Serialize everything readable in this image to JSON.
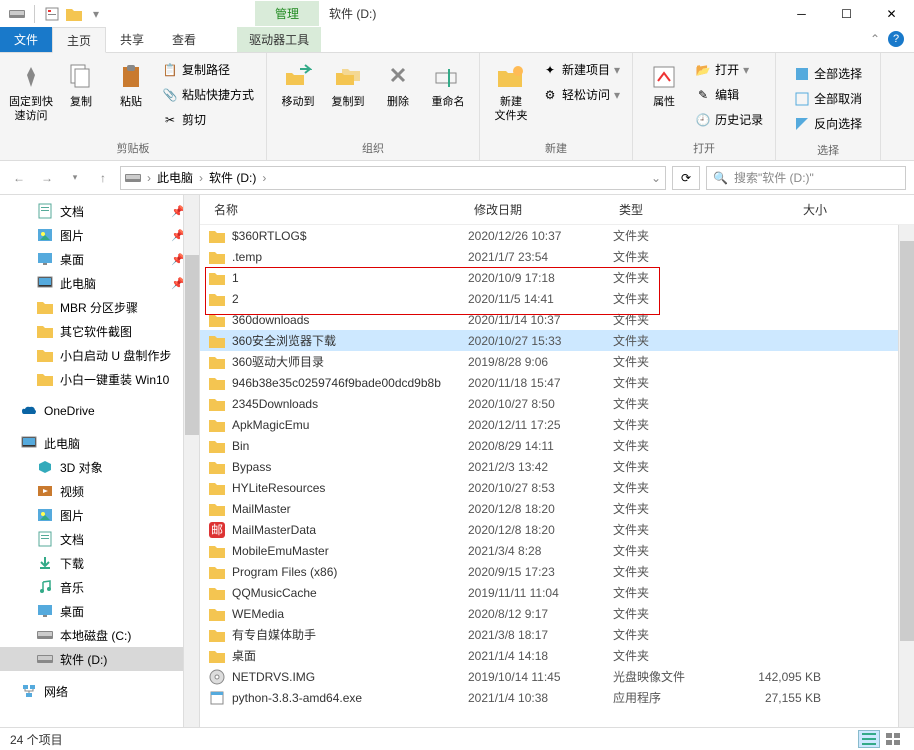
{
  "window": {
    "context_tab_header": "管理",
    "title": "软件 (D:)",
    "context_tab": "驱动器工具"
  },
  "tabs": {
    "file": "文件",
    "home": "主页",
    "share": "共享",
    "view": "查看"
  },
  "ribbon": {
    "pin": "固定到快\n速访问",
    "copy": "复制",
    "paste": "粘贴",
    "copy_path": "复制路径",
    "paste_shortcut": "粘贴快捷方式",
    "cut": "剪切",
    "clipboard_group": "剪贴板",
    "moveto": "移动到",
    "copyto": "复制到",
    "delete": "删除",
    "rename": "重命名",
    "organize_group": "组织",
    "newfolder": "新建\n文件夹",
    "newitem": "新建项目",
    "easyaccess": "轻松访问",
    "new_group": "新建",
    "properties": "属性",
    "open": "打开",
    "edit": "编辑",
    "history": "历史记录",
    "open_group": "打开",
    "selectall": "全部选择",
    "selectnone": "全部取消",
    "invertsel": "反向选择",
    "select_group": "选择"
  },
  "breadcrumb": {
    "pc": "此电脑",
    "drive": "软件 (D:)"
  },
  "search": {
    "placeholder": "搜索\"软件 (D:)\""
  },
  "nav": {
    "quick": [
      {
        "label": "文档",
        "icon": "doc",
        "pin": true
      },
      {
        "label": "图片",
        "icon": "pic",
        "pin": true
      },
      {
        "label": "桌面",
        "icon": "desk",
        "pin": true
      },
      {
        "label": "此电脑",
        "icon": "pc",
        "pin": true
      },
      {
        "label": "MBR 分区步骤",
        "icon": "folder"
      },
      {
        "label": "其它软件截图",
        "icon": "folder"
      },
      {
        "label": "小白启动 U 盘制作步",
        "icon": "folder"
      },
      {
        "label": "小白一键重装 Win10",
        "icon": "folder"
      }
    ],
    "onedrive": "OneDrive",
    "thispc": "此电脑",
    "pc_items": [
      {
        "label": "3D 对象",
        "icon": "3d"
      },
      {
        "label": "视频",
        "icon": "video"
      },
      {
        "label": "图片",
        "icon": "pic"
      },
      {
        "label": "文档",
        "icon": "doc"
      },
      {
        "label": "下载",
        "icon": "dl"
      },
      {
        "label": "音乐",
        "icon": "music"
      },
      {
        "label": "桌面",
        "icon": "desk"
      },
      {
        "label": "本地磁盘 (C:)",
        "icon": "drive"
      },
      {
        "label": "软件 (D:)",
        "icon": "drive",
        "sel": true
      }
    ],
    "network": "网络"
  },
  "columns": {
    "name": "名称",
    "date": "修改日期",
    "type": "类型",
    "size": "大小"
  },
  "rows": [
    {
      "name": "$360RTLOG$",
      "date": "2020/12/26 10:37",
      "type": "文件夹",
      "icon": "folder"
    },
    {
      "name": ".temp",
      "date": "2021/1/7 23:54",
      "type": "文件夹",
      "icon": "folder"
    },
    {
      "name": "1",
      "date": "2020/10/9 17:18",
      "type": "文件夹",
      "icon": "folder"
    },
    {
      "name": "2",
      "date": "2020/11/5 14:41",
      "type": "文件夹",
      "icon": "folder"
    },
    {
      "name": "360downloads",
      "date": "2020/11/14 10:37",
      "type": "文件夹",
      "icon": "folder"
    },
    {
      "name": "360安全浏览器下载",
      "date": "2020/10/27 15:33",
      "type": "文件夹",
      "icon": "folder",
      "sel": true
    },
    {
      "name": "360驱动大师目录",
      "date": "2019/8/28 9:06",
      "type": "文件夹",
      "icon": "folder"
    },
    {
      "name": "946b38e35c0259746f9bade00dcd9b8b",
      "date": "2020/11/18 15:47",
      "type": "文件夹",
      "icon": "folder"
    },
    {
      "name": "2345Downloads",
      "date": "2020/10/27 8:50",
      "type": "文件夹",
      "icon": "folder"
    },
    {
      "name": "ApkMagicEmu",
      "date": "2020/12/11 17:25",
      "type": "文件夹",
      "icon": "folder"
    },
    {
      "name": "Bin",
      "date": "2020/8/29 14:11",
      "type": "文件夹",
      "icon": "folder"
    },
    {
      "name": "Bypass",
      "date": "2021/2/3 13:42",
      "type": "文件夹",
      "icon": "folder"
    },
    {
      "name": "HYLiteResources",
      "date": "2020/10/27 8:53",
      "type": "文件夹",
      "icon": "folder"
    },
    {
      "name": "MailMaster",
      "date": "2020/12/8 18:20",
      "type": "文件夹",
      "icon": "folder"
    },
    {
      "name": "MailMasterData",
      "date": "2020/12/8 18:20",
      "type": "文件夹",
      "icon": "mailred"
    },
    {
      "name": "MobileEmuMaster",
      "date": "2021/3/4 8:28",
      "type": "文件夹",
      "icon": "folder"
    },
    {
      "name": "Program Files (x86)",
      "date": "2020/9/15 17:23",
      "type": "文件夹",
      "icon": "folder"
    },
    {
      "name": "QQMusicCache",
      "date": "2019/11/11 11:04",
      "type": "文件夹",
      "icon": "folder"
    },
    {
      "name": "WEMedia",
      "date": "2020/8/12 9:17",
      "type": "文件夹",
      "icon": "folder"
    },
    {
      "name": "有专自媒体助手",
      "date": "2021/3/8 18:17",
      "type": "文件夹",
      "icon": "folder"
    },
    {
      "name": "桌面",
      "date": "2021/1/4 14:18",
      "type": "文件夹",
      "icon": "folder"
    },
    {
      "name": "NETDRVS.IMG",
      "date": "2019/10/14 11:45",
      "type": "光盘映像文件",
      "size": "142,095 KB",
      "icon": "disc"
    },
    {
      "name": "python-3.8.3-amd64.exe",
      "date": "2021/1/4 10:38",
      "type": "应用程序",
      "size": "27,155 KB",
      "icon": "exe"
    }
  ],
  "status": {
    "count": "24 个项目"
  }
}
